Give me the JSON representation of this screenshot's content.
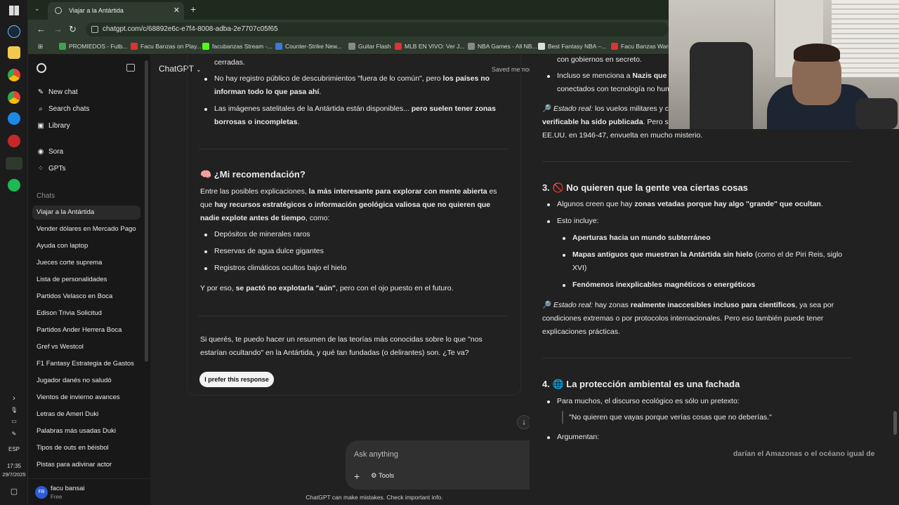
{
  "browser": {
    "tab_title": "Viajar a la Antártida",
    "url": "chatgpt.com/c/68892e6c-e7f4-8008-adba-2e7707c05f65",
    "bookmarks": [
      {
        "label": "PROMIEDOS - Futb...",
        "color": "#3fa34d"
      },
      {
        "label": "Facu Banzas on Play...",
        "color": "#d33"
      },
      {
        "label": "facubanzas Stream -...",
        "color": "#53fc18"
      },
      {
        "label": "Counter-Strike New...",
        "color": "#3a7bd5"
      },
      {
        "label": "Guitar Flash",
        "color": "#888"
      },
      {
        "label": "MLB EN VIVO: Ver J...",
        "color": "#d33"
      },
      {
        "label": "NBA Games - All NB...",
        "color": "#888"
      },
      {
        "label": "Best Fantasy NBA –...",
        "color": "#ddd"
      },
      {
        "label": "Facu Banzas Warrio...",
        "color": "#d33"
      }
    ]
  },
  "sidebar": {
    "top": [
      {
        "label": "New chat",
        "icon": "new-chat-icon",
        "glyph": "✎"
      },
      {
        "label": "Search chats",
        "icon": "search-icon",
        "glyph": "⌕"
      },
      {
        "label": "Library",
        "icon": "library-icon",
        "glyph": "▣"
      },
      {
        "label": "Sora",
        "icon": "sora-icon",
        "glyph": "◉"
      },
      {
        "label": "GPTs",
        "icon": "gpts-icon",
        "glyph": "⁘"
      }
    ],
    "chats_label": "Chats",
    "chats": [
      "Viajar a la Antártida",
      "Vender dólares en Mercado Pago",
      "Ayuda con laptop",
      "Jueces corte suprema",
      "Lista de personalidades",
      "Partidos Velasco en Boca",
      "Edison Trivia Solicitud",
      "Partidos Ander Herrera Boca",
      "Gref vs Westcol",
      "F1 Fantasy Estrategia de Gastos",
      "Jugador danés no saludó",
      "Vientos de invierno avances",
      "Letras de Ameri Duki",
      "Palabras más usadas Duki",
      "Tipos de outs en béisbol",
      "Pistas para adivinar actor"
    ],
    "user": {
      "initials": "FB",
      "name": "facu bansai",
      "plan": "Free"
    }
  },
  "header": {
    "model": "ChatGPT",
    "saved_memory": "Saved memory full"
  },
  "response1": {
    "line_cerradas": "cerradas.",
    "b1_pre": "No hay registro público de descubrimientos \"fuera de lo común\", pero ",
    "b1_bold": "los países no informan todo lo que pasa ahí",
    "b1_post": ".",
    "b2_pre": "Las imágenes satelitales de la Antártida están disponibles... ",
    "b2_bold": "pero suelen tener zonas borrosas o incompletas",
    "b2_post": ".",
    "rec_heading": "🧠 ¿Mi recomendación?",
    "rec_p_pre": "Entre las posibles explicaciones, ",
    "rec_p_b1": "la más interesante para explorar con mente abierta",
    "rec_p_mid": " es que ",
    "rec_p_b2": "hay recursos estratégicos o información geológica valiosa que no quieren que nadie explote antes de tiempo",
    "rec_p_post": ", como:",
    "items": [
      "Depósitos de minerales raros",
      "Reservas de agua dulce gigantes",
      "Registros climáticos ocultos bajo el hielo"
    ],
    "conclusion_pre": "Y por eso, ",
    "conclusion_bold": "se pactó no explotarla \"aún\"",
    "conclusion_post": ", pero con el ojo puesto en el futuro.",
    "offer": "Si querés, te puedo hacer un resumen de las teorías más conocidas sobre lo que \"nos estarían ocultando\" en la Antártida, y qué tan fundadas (o delirantes) son. ¿Te va?",
    "prefer_button": "I prefer this response"
  },
  "response2": {
    "l1": "con gobiernos en secreto.",
    "l2_pre": "Incluso se menciona a ",
    "l2_bold": "Nazis que h",
    "l3": "conectados con tecnología no hum",
    "estado1_icon": "🔎",
    "estado1_label": "Estado real:",
    "estado1_text": " los vuelos militares y ci",
    "estado1_l2_bold": "verificable ha sido publicada",
    "estado1_l2": ". Pero sí h",
    "estado1_l3": "EE.UU. en 1946-47, envuelta en mucho misterio.",
    "h3": "3. 🚫 No quieren que la gente vea ciertas cosas",
    "s3_b1_pre": "Algunos creen que hay ",
    "s3_b1_bold": "zonas vetadas porque hay algo \"grande\" que ocultan",
    "s3_b1_post": ".",
    "s3_b2": "Esto incluye:",
    "s3_sub1": "Aperturas hacia un mundo subterráneo",
    "s3_sub2_bold": "Mapas antiguos que muestran la Antártida sin hielo",
    "s3_sub2_post": " (como el de Piri Reis, siglo XVI)",
    "s3_sub3": "Fenómenos inexplicables magnéticos o energéticos",
    "estado2_label": "Estado real:",
    "estado2_pre": " hay zonas ",
    "estado2_bold": "realmente inaccesibles incluso para científicos",
    "estado2_post": ", ya sea por condiciones extremas o por protocolos internacionales. Pero eso también puede tener explicaciones prácticas.",
    "h4": "4. 🌐 La protección ambiental es una fachada",
    "s4_b1": "Para muchos, el discurso ecológico es sólo un pretexto:",
    "s4_quote": "\"No quieren que vayas porque verías cosas que no deberías.\"",
    "s4_b2": "Argumentan:",
    "s4_cut": "darían el Amazonas o el océano igual de"
  },
  "composer": {
    "placeholder": "Ask anything",
    "tools": "Tools"
  },
  "disclaimer": "ChatGPT can make mistakes. Check important info.",
  "system": {
    "lang": "ESP",
    "time": "17:35",
    "date": "29/7/2025"
  }
}
